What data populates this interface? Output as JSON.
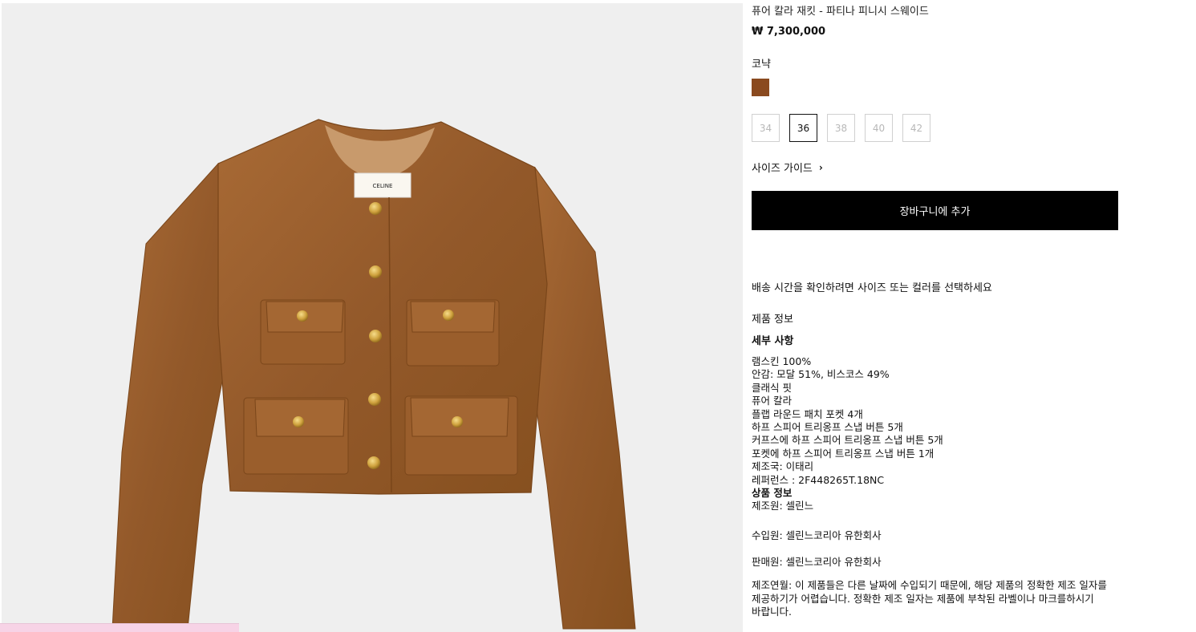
{
  "product": {
    "title": "퓨어 칼라 재킷 - 파티나 피니시 스웨이드",
    "price": "₩ 7,300,000",
    "color_name": "코냑",
    "swatch_color": "#8a4a1f",
    "sizes": [
      {
        "label": "34",
        "selected": false
      },
      {
        "label": "36",
        "selected": true
      },
      {
        "label": "38",
        "selected": false
      },
      {
        "label": "40",
        "selected": false
      },
      {
        "label": "42",
        "selected": false
      }
    ],
    "size_guide_label": "사이즈 가이드",
    "size_guide_icon": "chevron-right-icon",
    "add_to_cart_label": "장바구니에 추가",
    "shipping_note": "배송 시간을 확인하려면 사이즈 또는 컬러를 선택하세요",
    "info_heading": "제품 정보",
    "details_heading": "세부 사항",
    "specs": [
      "램스킨 100%",
      "안감: 모달 51%, 비스코스 49%",
      "클래식 핏",
      "퓨어 칼라",
      "플랩 라운드 패치 포켓 4개",
      "하프 스피어 트리옹프 스냅 버튼 5개",
      "커프스에 하프 스피어 트리옹프 스냅 버튼 5개",
      "포켓에 하프 스피어 트리옹프 스냅 버튼 1개",
      "제조국: 이태리",
      "레퍼런스 : 2F448265T.18NC"
    ],
    "product_info_heading": "상품 정보",
    "manufacturer": "제조원: 셀린느",
    "importer": "수입원: 셀린느코리아 유한회사",
    "seller": "판매원: 셀린느코리아 유한회사",
    "manufacture_date": "제조연월: 이 제품들은 다른 날짜에 수입되기 때문에, 해당 제품의 정확한 제조 일자를 제공하기가 어렵습니다. 정확한 제조 일자는 제품에 부착된 라벨이나 마크를하시기 바랍니다."
  },
  "image": {
    "label_brand": "CELINE",
    "background": "#efefef",
    "jacket_color": "#9a5e2c"
  }
}
